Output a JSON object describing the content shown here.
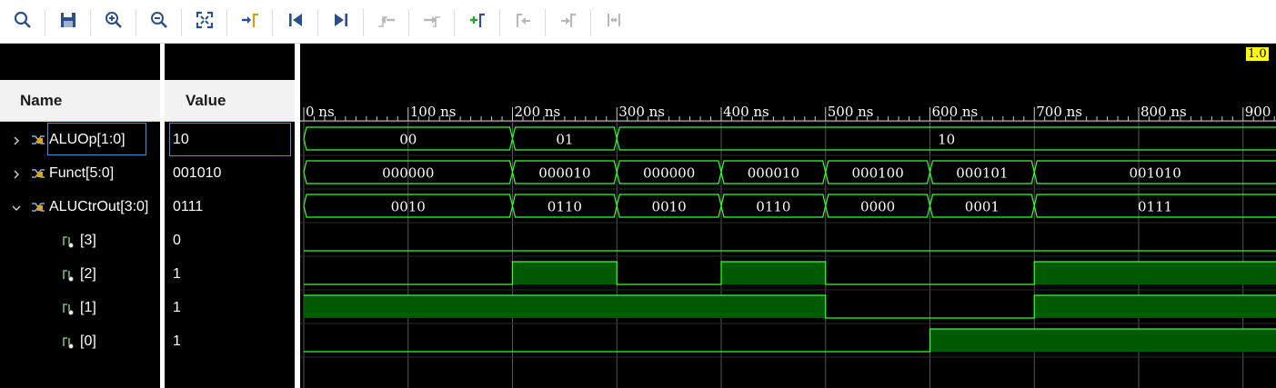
{
  "toolbar": {
    "buttons": [
      {
        "name": "search-icon",
        "enabled": true
      },
      {
        "name": "save-icon",
        "enabled": true
      },
      {
        "name": "zoom-in-icon",
        "enabled": true
      },
      {
        "name": "zoom-out-icon",
        "enabled": true
      },
      {
        "name": "zoom-fit-icon",
        "enabled": true
      },
      {
        "name": "go-to-cursor-icon",
        "enabled": true
      },
      {
        "name": "go-to-start-icon",
        "enabled": true
      },
      {
        "name": "go-to-end-icon",
        "enabled": true
      },
      {
        "name": "previous-transition-icon",
        "enabled": false
      },
      {
        "name": "next-transition-icon",
        "enabled": false
      },
      {
        "name": "add-marker-icon",
        "enabled": true
      },
      {
        "name": "previous-marker-icon",
        "enabled": false
      },
      {
        "name": "next-marker-icon",
        "enabled": false
      },
      {
        "name": "swap-cursors-icon",
        "enabled": false
      }
    ]
  },
  "columns": {
    "name": "Name",
    "value": "Value"
  },
  "cursor_label": "1.0",
  "timeline": {
    "ticks": [
      "0 ns",
      "100 ns",
      "200 ns",
      "300 ns",
      "400 ns",
      "500 ns",
      "600 ns",
      "700 ns",
      "800 ns",
      "900"
    ]
  },
  "signals": [
    {
      "name": "ALUOp[1:0]",
      "value": "10",
      "expandable": true,
      "expanded": false,
      "selected": true,
      "segments": [
        {
          "from": 0,
          "to": 200,
          "label": "00"
        },
        {
          "from": 200,
          "to": 300,
          "label": "01"
        },
        {
          "from": 300,
          "to": 940,
          "label": "10"
        }
      ]
    },
    {
      "name": "Funct[5:0]",
      "value": "001010",
      "expandable": true,
      "expanded": false,
      "selected": false,
      "segments": [
        {
          "from": 0,
          "to": 200,
          "label": "000000"
        },
        {
          "from": 200,
          "to": 300,
          "label": "000010"
        },
        {
          "from": 300,
          "to": 400,
          "label": "000000"
        },
        {
          "from": 400,
          "to": 500,
          "label": "000010"
        },
        {
          "from": 500,
          "to": 600,
          "label": "000100"
        },
        {
          "from": 600,
          "to": 700,
          "label": "000101"
        },
        {
          "from": 700,
          "to": 940,
          "label": "001010"
        }
      ]
    },
    {
      "name": "ALUCtrOut[3:0]",
      "value": "0111",
      "expandable": true,
      "expanded": true,
      "selected": false,
      "segments": [
        {
          "from": 0,
          "to": 200,
          "label": "0010"
        },
        {
          "from": 200,
          "to": 300,
          "label": "0110"
        },
        {
          "from": 300,
          "to": 400,
          "label": "0010"
        },
        {
          "from": 400,
          "to": 500,
          "label": "0110"
        },
        {
          "from": 500,
          "to": 600,
          "label": "0000"
        },
        {
          "from": 600,
          "to": 700,
          "label": "0001"
        },
        {
          "from": 700,
          "to": 940,
          "label": "0111"
        }
      ]
    },
    {
      "name": "[3]",
      "value": "0",
      "bit": true,
      "high": []
    },
    {
      "name": "[2]",
      "value": "1",
      "bit": true,
      "high": [
        [
          200,
          300
        ],
        [
          400,
          500
        ],
        [
          700,
          940
        ]
      ]
    },
    {
      "name": "[1]",
      "value": "1",
      "bit": true,
      "high": [
        [
          0,
          500
        ],
        [
          700,
          940
        ]
      ]
    },
    {
      "name": "[0]",
      "value": "1",
      "bit": true,
      "high": [
        [
          600,
          940
        ]
      ]
    }
  ],
  "colors": {
    "wave": "#33ff33",
    "high_fill": "#005a00",
    "grid": "#555555",
    "bus_text": "#ffffff",
    "cursor_bg": "#ffff00"
  }
}
